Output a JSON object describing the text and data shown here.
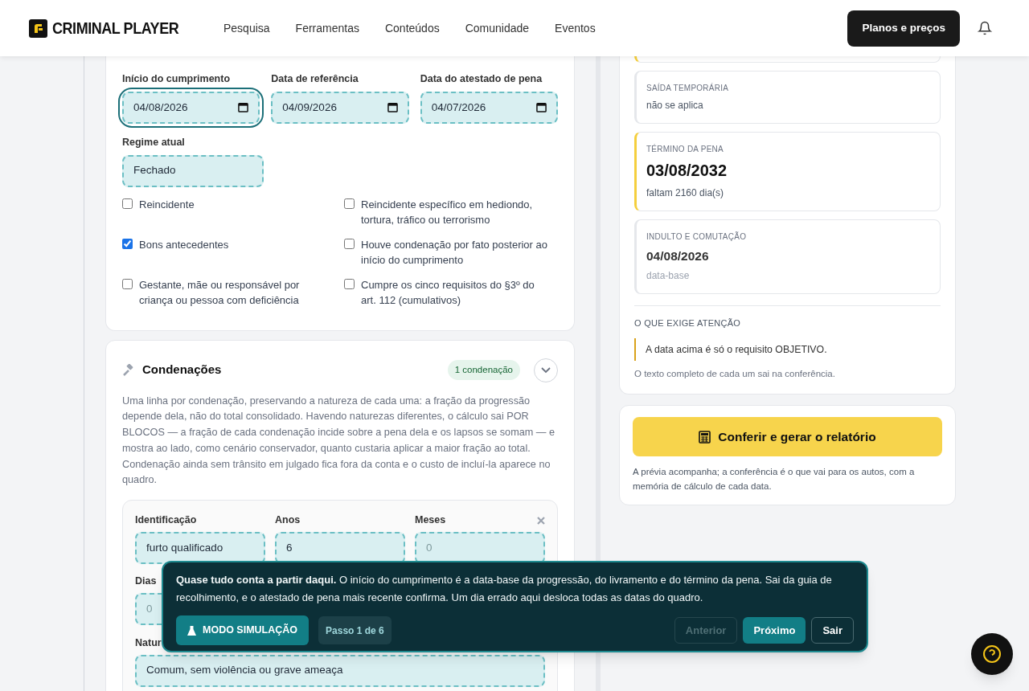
{
  "header": {
    "brand": "CRIMINAL PLAYER",
    "nav": [
      "Pesquisa",
      "Ferramentas",
      "Conteúdos",
      "Comunidade",
      "Eventos"
    ],
    "cta": "Planos e preços"
  },
  "dates": [
    {
      "label": "Início do cumprimento",
      "value": "04/08/2026",
      "focused": true
    },
    {
      "label": "Data de referência",
      "value": "04/09/2026",
      "focused": false
    },
    {
      "label": "Data do atestado de pena",
      "value": "04/07/2026",
      "focused": false
    }
  ],
  "regime": {
    "label": "Regime atual",
    "value": "Fechado"
  },
  "checks": [
    {
      "label": "Reincidente",
      "checked": false
    },
    {
      "label": "Reincidente específico em hediondo, tortura, tráfico ou terrorismo",
      "checked": false
    },
    {
      "label": "Bons antecedentes",
      "checked": true
    },
    {
      "label": "Houve condenação por fato posterior ao início do cumprimento",
      "checked": false
    },
    {
      "label": "Gestante, mãe ou responsável por criança ou pessoa com deficiência",
      "checked": false
    },
    {
      "label": "Cumpre os cinco requisitos do §3º do art. 112 (cumulativos)",
      "checked": false
    }
  ],
  "condenacoes": {
    "title": "Condenações",
    "badge": "1 condenação",
    "description": "Uma linha por condenação, preservando a natureza de cada uma: a fração da progressão depende dela, não do total consolidado. Havendo naturezas diferentes, o cálculo sai POR BLOCOS — a fração de cada condenação incide sobre a pena dela e os lapsos se somam — e mostra ao lado, como cenário conservador, quanto custaria aplicar a maior fração ao total. Condenação ainda sem trânsito em julgado fica fora da conta e o custo de incluí-la aparece no quadro.",
    "fields": [
      {
        "label": "Identificação",
        "value": "furto qualificado"
      },
      {
        "label": "Anos",
        "value": "6"
      },
      {
        "label": "Meses",
        "placeholder": "0"
      }
    ],
    "dias": {
      "label": "Dias",
      "placeholder": "0"
    },
    "natureza": {
      "label": "Natur",
      "value": "Comum, sem violência ou grave ameaça"
    }
  },
  "summary": {
    "cards": [
      {
        "label": "SAÍDA TEMPORÁRIA",
        "value": "não se aplica",
        "highlight": false,
        "kind": "plain"
      },
      {
        "label": "TÉRMINO DA PENA",
        "value": "03/08/2032",
        "note": "faltam 2160 dia(s)",
        "highlight": true,
        "kind": "big"
      },
      {
        "label": "INDULTO E COMUTAÇÃO",
        "value": "04/08/2026",
        "note": "data-base",
        "highlight": false,
        "kind": "medium"
      }
    ],
    "attention_title": "O QUE EXIGE ATENÇÃO",
    "attention": "A data acima é só o requisito OBJETIVO.",
    "attention_note": "O texto completo de cada um sai na conferência."
  },
  "report": {
    "button": "Conferir e gerar o relatório",
    "note": "A prévia acompanha; a conferência é o que vai para os autos, com a memória de cálculo de cada data."
  },
  "tour": {
    "body": "**Quase tudo conta a partir daqui.** O início do cumprimento é a data-base da progressão, do livramento e do término da pena. Sai da guia de recolhimento, e o atestado de pena mais recente confirma. Um dia errado aqui desloca todas as datas do quadro.",
    "mode": "MODO SIMULAÇÃO",
    "step": "Passo 1 de 6",
    "buttons": [
      {
        "label": "Anterior",
        "kind": "outline",
        "disabled": true
      },
      {
        "label": "Próximo",
        "kind": "primary",
        "disabled": false
      },
      {
        "label": "Sair",
        "kind": "outline",
        "disabled": false
      }
    ]
  }
}
